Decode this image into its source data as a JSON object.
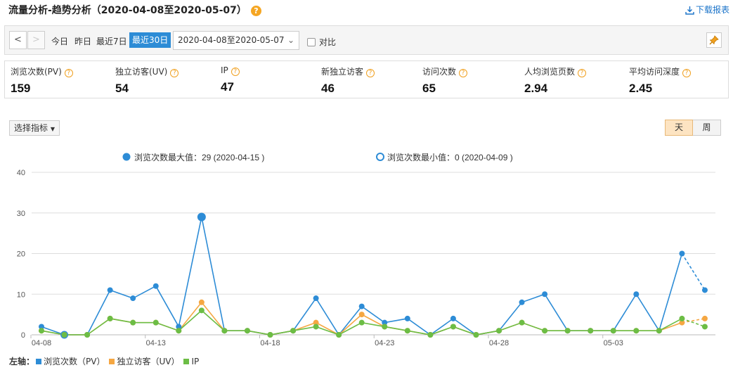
{
  "header": {
    "title": "流量分析-趋势分析（2020-04-08至2020-05-07）",
    "help": "?",
    "download_label": "下载报表"
  },
  "toolbar": {
    "prev": "<",
    "next": ">",
    "ranges": [
      "今日",
      "昨日",
      "最近7日",
      "最近30日"
    ],
    "active_range": "最近30日",
    "date_range": "2020-04-08至2020-05-07",
    "compare_label": "对比"
  },
  "metrics": [
    {
      "label": "浏览次数(PV)",
      "value": "159"
    },
    {
      "label": "独立访客(UV)",
      "value": "54"
    },
    {
      "label": "IP",
      "value": "47"
    },
    {
      "label": "新独立访客",
      "value": "46"
    },
    {
      "label": "访问次数",
      "value": "65"
    },
    {
      "label": "人均浏览页数",
      "value": "2.94"
    },
    {
      "label": "平均访问深度",
      "value": "2.45"
    }
  ],
  "controls": {
    "select_metric": "选择指标",
    "period_day": "天",
    "period_week": "周"
  },
  "chart_data": {
    "type": "line",
    "ylim": [
      0,
      40
    ],
    "yticks": [
      "0",
      "10",
      "20",
      "30",
      "40"
    ],
    "x": [
      "04-08",
      "04-09",
      "04-10",
      "04-11",
      "04-12",
      "04-13",
      "04-14",
      "04-15",
      "04-16",
      "04-17",
      "04-18",
      "04-19",
      "04-20",
      "04-21",
      "04-22",
      "04-23",
      "04-24",
      "04-25",
      "04-26",
      "04-27",
      "04-28",
      "04-29",
      "04-30",
      "05-01",
      "05-02",
      "05-03",
      "05-04",
      "05-05",
      "05-06",
      "05-07"
    ],
    "xtick_labels": [
      "04-08",
      "04-13",
      "04-18",
      "04-23",
      "04-28",
      "05-03"
    ],
    "series": [
      {
        "name": "浏览次数（PV）",
        "color": "#2d8cd6",
        "values": [
          2,
          0,
          0,
          11,
          9,
          12,
          2,
          29,
          1,
          1,
          0,
          1,
          9,
          0,
          7,
          3,
          4,
          0,
          4,
          0,
          1,
          8,
          10,
          1,
          1,
          1,
          10,
          1,
          20,
          11
        ]
      },
      {
        "name": "独立访客（UV）",
        "color": "#f5a742",
        "values": [
          1,
          0,
          0,
          4,
          3,
          3,
          1,
          8,
          1,
          1,
          0,
          1,
          3,
          0,
          5,
          2,
          1,
          0,
          2,
          0,
          1,
          3,
          1,
          1,
          1,
          1,
          1,
          1,
          3,
          4
        ]
      },
      {
        "name": "IP",
        "color": "#6cbd45",
        "values": [
          1,
          0,
          0,
          4,
          3,
          3,
          1,
          6,
          1,
          1,
          0,
          1,
          2,
          0,
          3,
          2,
          1,
          0,
          2,
          0,
          1,
          3,
          1,
          1,
          1,
          1,
          1,
          1,
          4,
          2
        ]
      }
    ],
    "annotations": {
      "max_label": "浏览次数最大值：29 (2020-04-15 )",
      "min_label": "浏览次数最小值：0 (2020-04-09 )"
    },
    "legend_prefix": "左轴："
  }
}
